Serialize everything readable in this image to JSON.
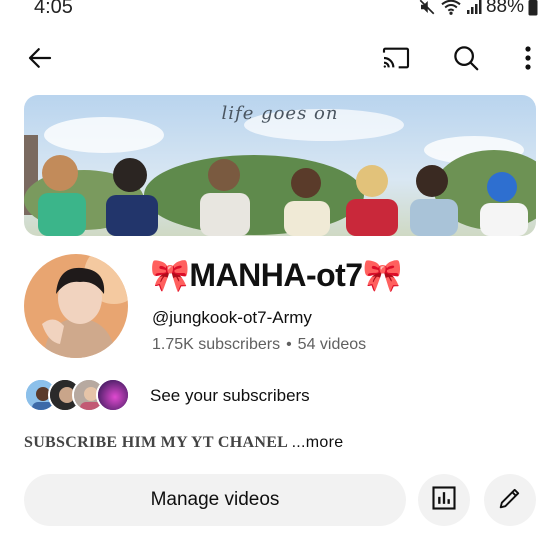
{
  "status_bar": {
    "time": "4:05",
    "battery": "88%"
  },
  "app_bar": {
    "back_icon": "arrow-left-icon",
    "cast_icon": "cast-icon",
    "search_icon": "search-icon",
    "more_icon": "more-vert-icon"
  },
  "banner": {
    "text": "life goes on"
  },
  "channel": {
    "name": "🎀MANHA-ot7🎀",
    "handle": "@jungkook-ot7-Army",
    "subscribers": "1.75K subscribers",
    "separator": "•",
    "videos": "54 videos"
  },
  "subscribers_row": {
    "label": "See your subscribers"
  },
  "description": {
    "text": "SUBSCRIBE HIM MY YT CHANEL ",
    "more": "...more"
  },
  "actions": {
    "manage_label": "Manage videos",
    "analytics_icon": "analytics-icon",
    "edit_icon": "edit-icon"
  },
  "colors": {
    "button_bg": "#f2f2f2",
    "secondary_text": "#606060"
  }
}
